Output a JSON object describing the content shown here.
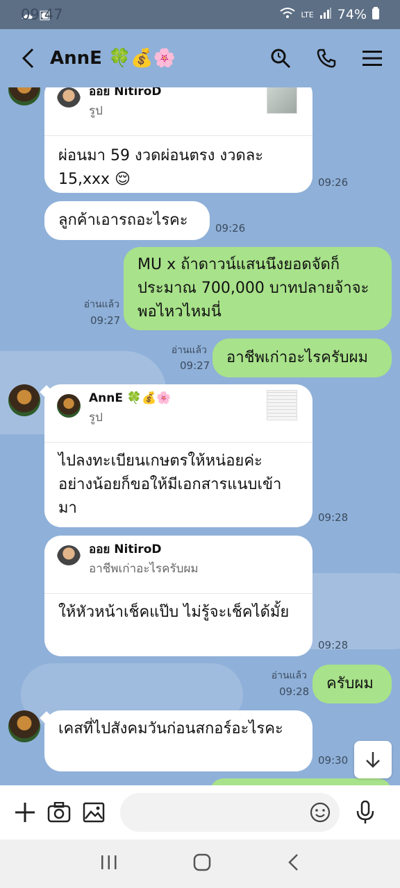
{
  "status_bar": {
    "time": "09:47",
    "battery": "74%",
    "network": "LTE"
  },
  "header": {
    "contact_name": "AnnE 🍀💰🌸"
  },
  "messages": {
    "m1": {
      "reply_name": "ออย NitiroD",
      "reply_sub": "รูป",
      "text": "ผ่อนมา 59 งวดผ่อนตรง งวดละ 15,xxx 😌",
      "time": "09:26"
    },
    "m2": {
      "text": "ลูกค้าเอารถอะไรคะ",
      "time": "09:26"
    },
    "m3": {
      "text": "MU x ถ้าดาวน์แสนนึงยอดจัดก็ประมาณ 700,000 บาทปลายจ้าจะพอไหวไหมนี่",
      "read": "อ่านแล้ว",
      "time": "09:27"
    },
    "m4": {
      "text": "อาชีพเก่าอะไรครับผม",
      "read": "อ่านแล้ว",
      "time": "09:27"
    },
    "m5": {
      "reply_name": "AnnE 🍀💰🌸",
      "reply_sub": "รูป",
      "text": "ไปลงทะเบียนเกษตรให้หน่อยค่ะ อย่างน้อยก็ขอให้มีเอกสารแนบเข้ามา",
      "time": "09:28"
    },
    "m6": {
      "reply_name": "ออย NitiroD",
      "reply_sub": "อาชีพเก่าอะไรครับผม",
      "text": "ให้หัวหน้าเช็คแป๊บ ไม่รู้จะเช็คได้มั้ย",
      "time": "09:28"
    },
    "m7": {
      "text": "ครับผม",
      "read": "อ่านแล้ว",
      "time": "09:28"
    },
    "m8": {
      "text": "เคสที่ไปสังคมวันก่อนสกอร์อะไรคะ",
      "time": "09:30"
    }
  },
  "input": {
    "placeholder": ""
  }
}
